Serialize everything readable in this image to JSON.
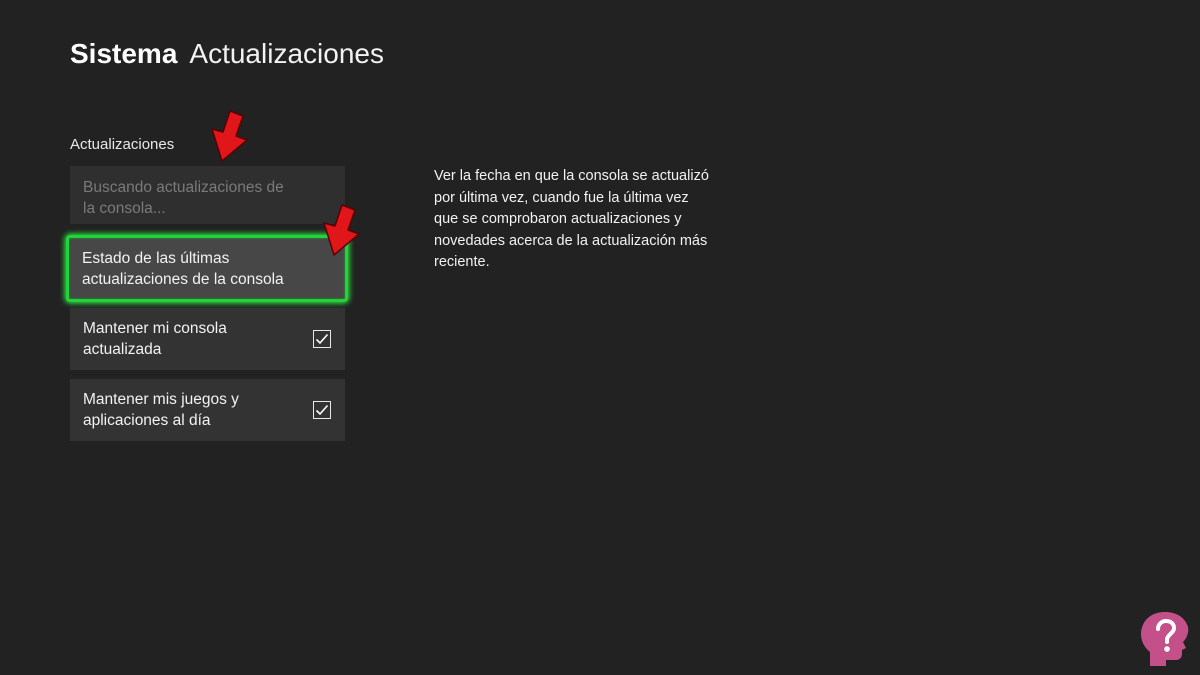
{
  "header": {
    "section": "Sistema",
    "page": "Actualizaciones"
  },
  "updates_group": {
    "label": "Actualizaciones",
    "items": [
      {
        "label": "Buscando actualizaciones de la consola...",
        "state": "disabled"
      },
      {
        "label": "Estado de las últimas actualizaciones de la consola",
        "state": "focused"
      },
      {
        "label": "Mantener mi consola actualizada",
        "checked": true
      },
      {
        "label": "Mantener mis juegos y aplicaciones al día",
        "checked": true
      }
    ]
  },
  "description": "Ver la fecha en que la consola se actualizó por última vez, cuando fue la última vez que se comprobaron actualizaciones y novedades acerca de la actualización más reciente.",
  "colors": {
    "background": "#222222",
    "focus_border": "#22d33a",
    "annotation_arrow": "#e0161b",
    "logo": "#c4508a"
  },
  "icons": {
    "checkbox": "checkbox-checked-icon",
    "annotation": "red-arrow-icon",
    "logo": "question-head-logo"
  }
}
